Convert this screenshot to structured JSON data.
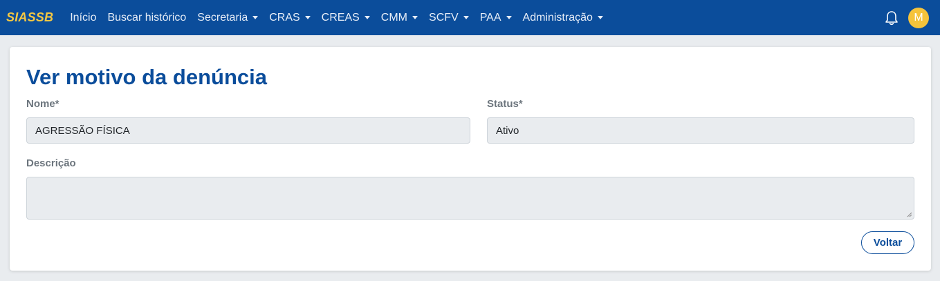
{
  "app": {
    "brand": "SIASSB"
  },
  "nav": {
    "items": [
      {
        "label": "Início",
        "dropdown": false
      },
      {
        "label": "Buscar histórico",
        "dropdown": false
      },
      {
        "label": "Secretaria",
        "dropdown": true
      },
      {
        "label": "CRAS",
        "dropdown": true
      },
      {
        "label": "CREAS",
        "dropdown": true
      },
      {
        "label": "CMM",
        "dropdown": true
      },
      {
        "label": "SCFV",
        "dropdown": true
      },
      {
        "label": "PAA",
        "dropdown": true
      },
      {
        "label": "Administração",
        "dropdown": true
      }
    ],
    "bell_icon": "bell-icon",
    "avatar_initial": "M"
  },
  "page": {
    "title": "Ver motivo da denúncia",
    "nome_label": "Nome*",
    "nome_value": "AGRESSÃO FÍSICA",
    "status_label": "Status*",
    "status_value": "Ativo",
    "descricao_label": "Descrição",
    "descricao_value": "",
    "back_button": "Voltar"
  },
  "colors": {
    "navbar": "#0b4d9b",
    "brand": "#f5c842",
    "avatar": "#f5c33b",
    "title": "#0b4d9b"
  }
}
